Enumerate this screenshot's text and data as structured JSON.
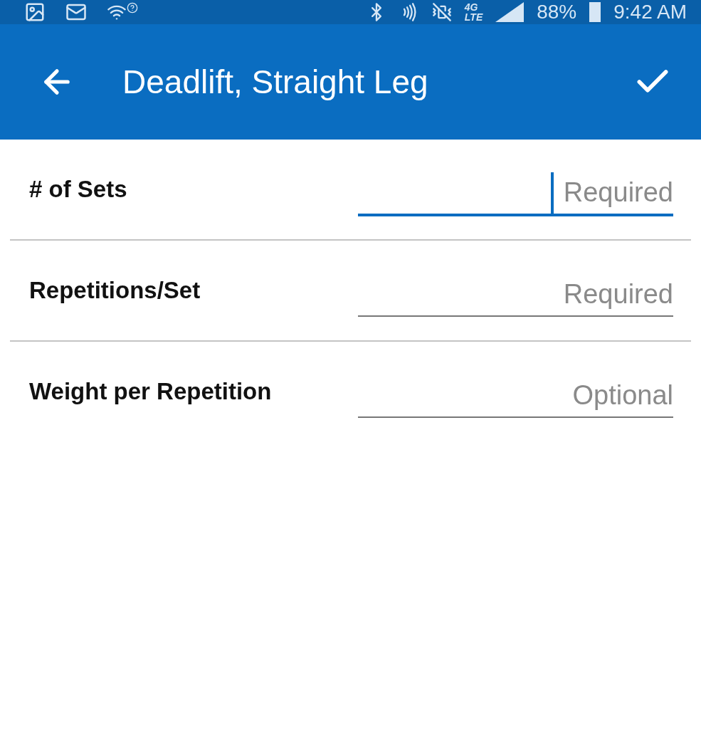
{
  "status_bar": {
    "network": [
      "4G",
      "LTE"
    ],
    "battery": "88%",
    "time": "9:42 AM"
  },
  "app_bar": {
    "title": "Deadlift, Straight Leg"
  },
  "fields": [
    {
      "label": "# of Sets",
      "placeholder": "Required",
      "focused": true
    },
    {
      "label": "Repetitions/Set",
      "placeholder": "Required",
      "focused": false
    },
    {
      "label": "Weight per Repetition",
      "placeholder": "Optional",
      "focused": false
    }
  ]
}
